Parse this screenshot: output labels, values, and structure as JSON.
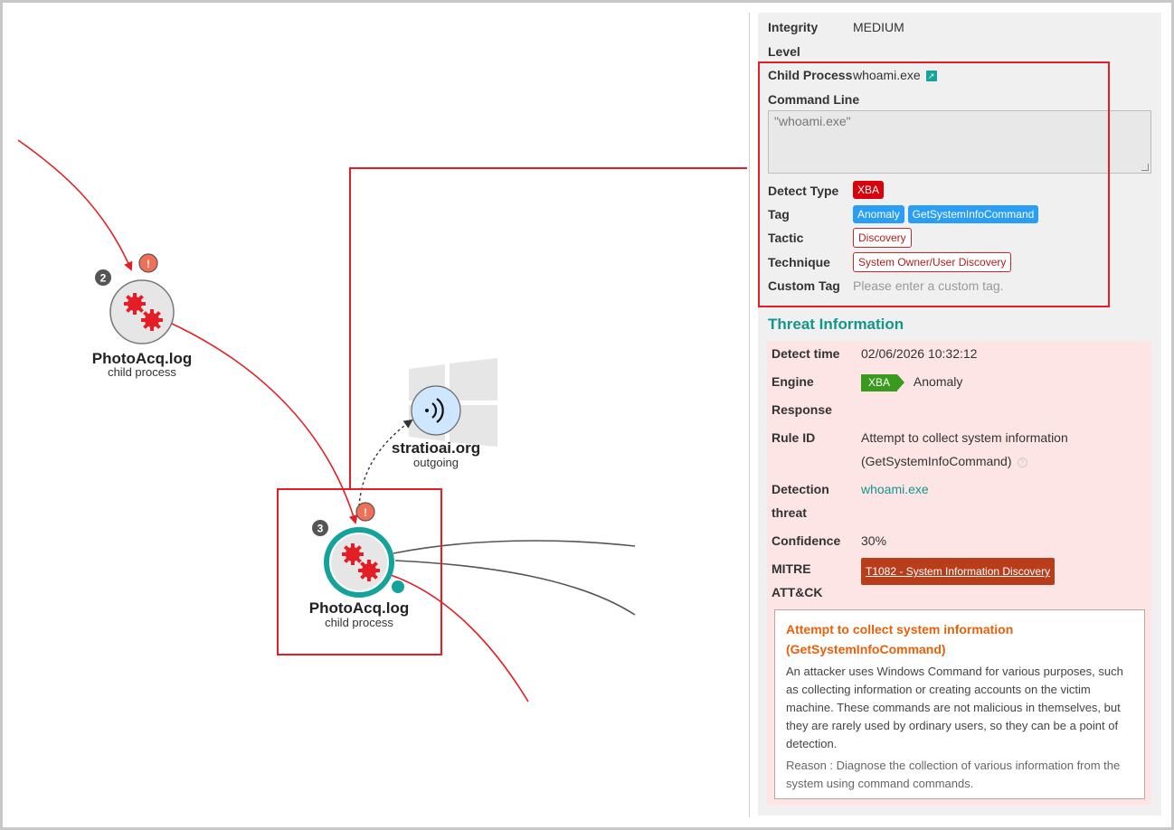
{
  "graph": {
    "node_a": {
      "badge": "2",
      "title": "PhotoAcq.log",
      "subtitle": "child process"
    },
    "node_b": {
      "badge": "3",
      "title": "PhotoAcq.log",
      "subtitle": "child process"
    },
    "node_net": {
      "title": "stratioai.org",
      "subtitle": "outgoing"
    },
    "alert_glyph": "!"
  },
  "details": {
    "integrity_label": "Integrity",
    "level_label": "Level",
    "integrity_value": "MEDIUM",
    "child_process_label": "Child Process",
    "child_process_value": "whoami.exe",
    "command_line_label": "Command Line",
    "command_line_value": "\"whoami.exe\"",
    "detect_type_label": "Detect Type",
    "detect_type_value": "XBA",
    "tag_label": "Tag",
    "tags": [
      "Anomaly",
      "GetSystemInfoCommand"
    ],
    "tactic_label": "Tactic",
    "tactic_value": "Discovery",
    "technique_label": "Technique",
    "technique_value": "System Owner/User Discovery",
    "custom_tag_label": "Custom Tag",
    "custom_tag_placeholder": "Please enter a custom tag."
  },
  "threat": {
    "section_title": "Threat Information",
    "detect_time_label": "Detect time",
    "detect_time_value": "02/06/2026 10:32:12",
    "engine_label": "Engine",
    "engine_badge": "XBA",
    "engine_value": "Anomaly",
    "response_label": "Response",
    "rule_id_label": "Rule ID",
    "rule_id_value_1": "Attempt to collect system information",
    "rule_id_value_2": "(GetSystemInfoCommand)",
    "detection_label_1": "Detection",
    "detection_label_2": "threat",
    "detection_value": "whoami.exe",
    "confidence_label": "Confidence",
    "confidence_value": "30%",
    "mitre_label_1": "MITRE",
    "mitre_label_2": "ATT&CK",
    "mitre_value": "T1082 - System Information Discovery",
    "desc_title_1": "Attempt to collect system information",
    "desc_title_2": "(GetSystemInfoCommand)",
    "desc_body": "An attacker uses Windows Command for various purposes, such as collecting information or creating accounts on the victim machine. These commands are not malicious in themselves, but they are rarely used by ordinary users, so they can be a point of detection.",
    "desc_reason": "Reason : Diagnose the collection of various information from the system using command commands."
  },
  "colors": {
    "accent_teal": "#14958a",
    "highlight_red": "#e41e26",
    "threat_bg": "#fde5e5",
    "alert_orange": "#f07056"
  }
}
